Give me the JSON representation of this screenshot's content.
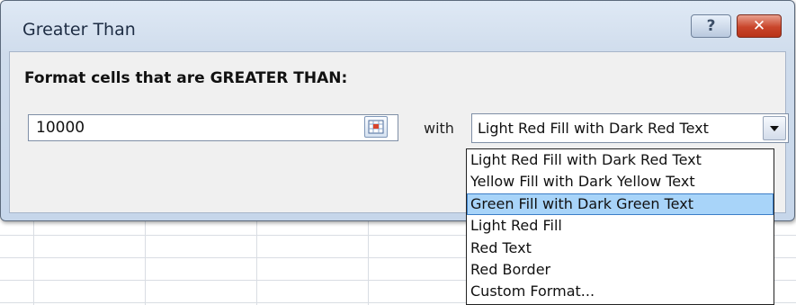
{
  "dialog": {
    "title": "Greater Than",
    "help_label": "?",
    "close_label": "✕",
    "prompt": "Format cells that are GREATER THAN:",
    "value": "10000",
    "with_label": "with",
    "format_selected": "Light Red Fill with Dark Red Text",
    "format_options": [
      "Light Red Fill with Dark Red Text",
      "Yellow Fill with Dark Yellow Text",
      "Green Fill with Dark Green Text",
      "Light Red Fill",
      "Red Text",
      "Red Border",
      "Custom Format..."
    ],
    "highlighted_option": "Green Fill with Dark Green Text"
  },
  "icons": {
    "range_select": "range-select-icon",
    "dropdown": "chevron-down-icon",
    "help": "help-icon",
    "close": "close-icon"
  },
  "colors": {
    "dialog_bg": "#cfdcec",
    "close_button": "#c9452b",
    "highlight": "#a8d4f9"
  }
}
